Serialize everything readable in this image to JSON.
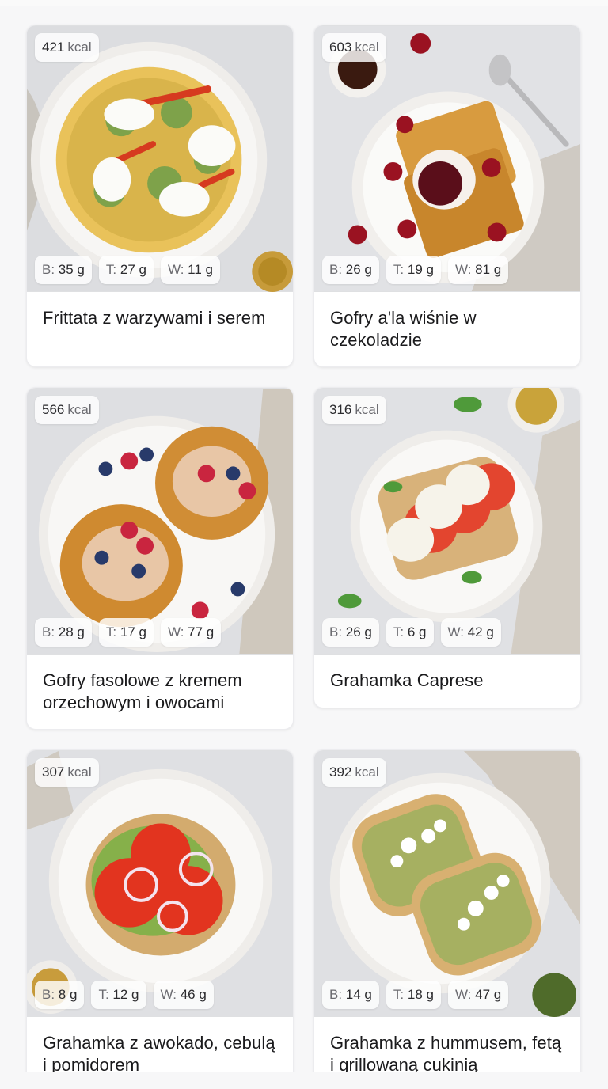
{
  "recipes": [
    {
      "kcal": "421",
      "kcal_unit": "kcal",
      "protein": "35 g",
      "fat": "27 g",
      "carbs": "11 g",
      "title": "Frittata z warzywami i serem",
      "image": "frittata"
    },
    {
      "kcal": "603",
      "kcal_unit": "kcal",
      "protein": "26 g",
      "fat": "19 g",
      "carbs": "81 g",
      "title": "Gofry a'la wiśnie w czekoladzie",
      "image": "waffles-cherry"
    },
    {
      "kcal": "566",
      "kcal_unit": "kcal",
      "protein": "28 g",
      "fat": "17 g",
      "carbs": "77 g",
      "title": "Gofry fasolowe z kremem orzechowym i owocami",
      "image": "waffles-berries"
    },
    {
      "kcal": "316",
      "kcal_unit": "kcal",
      "protein": "26 g",
      "fat": "6 g",
      "carbs": "42 g",
      "title": "Grahamka Caprese",
      "image": "caprese-toast"
    },
    {
      "kcal": "307",
      "kcal_unit": "kcal",
      "protein": "8 g",
      "fat": "12 g",
      "carbs": "46 g",
      "title": "Grahamka z awokado, cebulą i pomidorem",
      "image": "avocado-toast"
    },
    {
      "kcal": "392",
      "kcal_unit": "kcal",
      "protein": "14 g",
      "fat": "18 g",
      "carbs": "47 g",
      "title": "Grahamka z hummusem, fetą i grillowaną cukinią",
      "image": "hummus-toast"
    }
  ],
  "macro_prefixes": {
    "protein": "B:",
    "fat": "T:",
    "carbs": "W:"
  }
}
